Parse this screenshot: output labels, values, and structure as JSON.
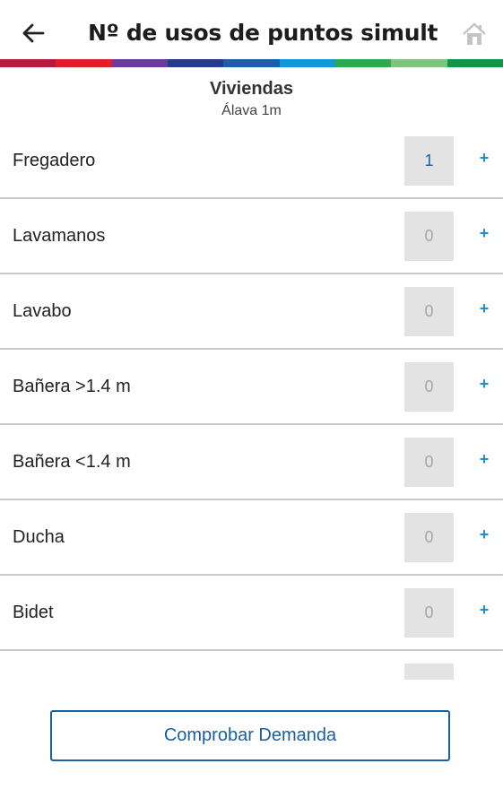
{
  "app": {
    "title": "Nº de usos de puntos simultá…"
  },
  "colors": {
    "stripe": [
      "#b51c3f",
      "#e21f26",
      "#6a3a9e",
      "#233d8e",
      "#1b5fa8",
      "#1497d4",
      "#33a84b",
      "#7bc57c",
      "#159447"
    ],
    "accent": "#1b5e9e",
    "plus": "#1a8fd8"
  },
  "header": {
    "category": "Viviendas",
    "location": "Álava 1m"
  },
  "items": [
    {
      "label": "Fregadero",
      "value": "1"
    },
    {
      "label": "Lavamanos",
      "value": "0"
    },
    {
      "label": "Lavabo",
      "value": "0"
    },
    {
      "label": "Bañera >1.4 m",
      "value": "0"
    },
    {
      "label": "Bañera <1.4 m",
      "value": "0"
    },
    {
      "label": "Ducha",
      "value": "0"
    },
    {
      "label": "Bidet",
      "value": "0"
    }
  ],
  "plus_symbol": "+",
  "actions": {
    "check_label": "Comprobar Demanda"
  }
}
